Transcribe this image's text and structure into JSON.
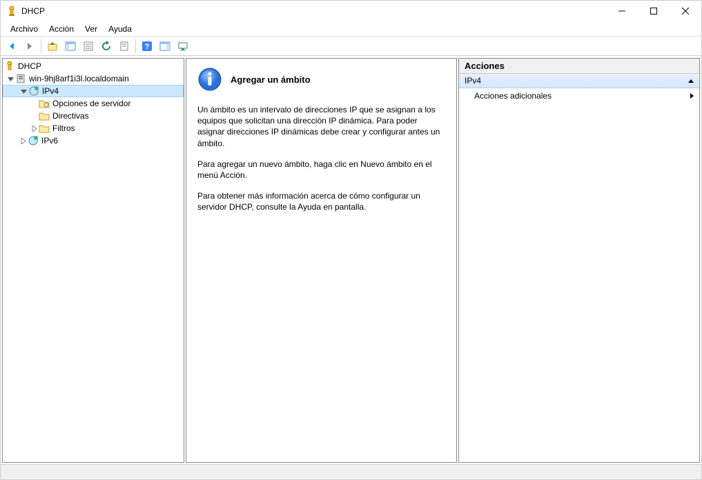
{
  "window": {
    "title": "DHCP"
  },
  "menubar": {
    "items": [
      "Archivo",
      "Acción",
      "Ver",
      "Ayuda"
    ]
  },
  "tree": {
    "root": "DHCP",
    "server": "win-9hj8arf1i3l.localdomain",
    "ipv4": "IPv4",
    "ipv4_children": {
      "opciones": "Opciones de servidor",
      "directivas": "Directivas",
      "filtros": "Filtros"
    },
    "ipv6": "IPv6"
  },
  "main": {
    "title": "Agregar un ámbito",
    "p1": "Un ámbito es un intervalo de direcciones IP que se asignan a los equipos que solicitan una dirección IP dinámica. Para poder asignar direcciones IP dinámicas debe crear y configurar antes un ámbito.",
    "p2": "Para agregar un nuevo ámbito, haga clic en Nuevo ámbito en el menú Acción.",
    "p3": "Para obtener más información acerca de cómo configurar un servidor DHCP, consulte la Ayuda en pantalla."
  },
  "actions": {
    "header": "Acciones",
    "section": "IPv4",
    "item1": "Acciones adicionales"
  }
}
